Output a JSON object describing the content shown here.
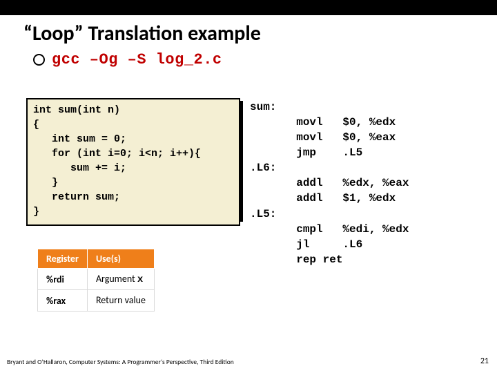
{
  "title": "“Loop” Translation example",
  "command": "gcc –Og –S log_2.c",
  "c_code": "int sum(int n)\n{\n   int sum = 0;\n   for (int i=0; i<n; i++){\n      sum += i;\n   }\n   return sum;\n}",
  "asm": "sum:\n       movl   $0, %edx\n       movl   $0, %eax\n       jmp    .L5\n.L6:\n       addl   %edx, %eax\n       addl   $1, %edx\n.L5:\n       cmpl   %edi, %edx\n       jl     .L6\n       rep ret",
  "table": {
    "headers": [
      "Register",
      "Use(s)"
    ],
    "rows": [
      {
        "reg": "%rdi",
        "use_prefix": "Argument ",
        "use_code": "x"
      },
      {
        "reg": "%rax",
        "use_prefix": "Return value",
        "use_code": ""
      }
    ]
  },
  "footer": "Bryant and O’Hallaron, Computer Systems: A Programmer’s Perspective, Third Edition",
  "page": "21"
}
